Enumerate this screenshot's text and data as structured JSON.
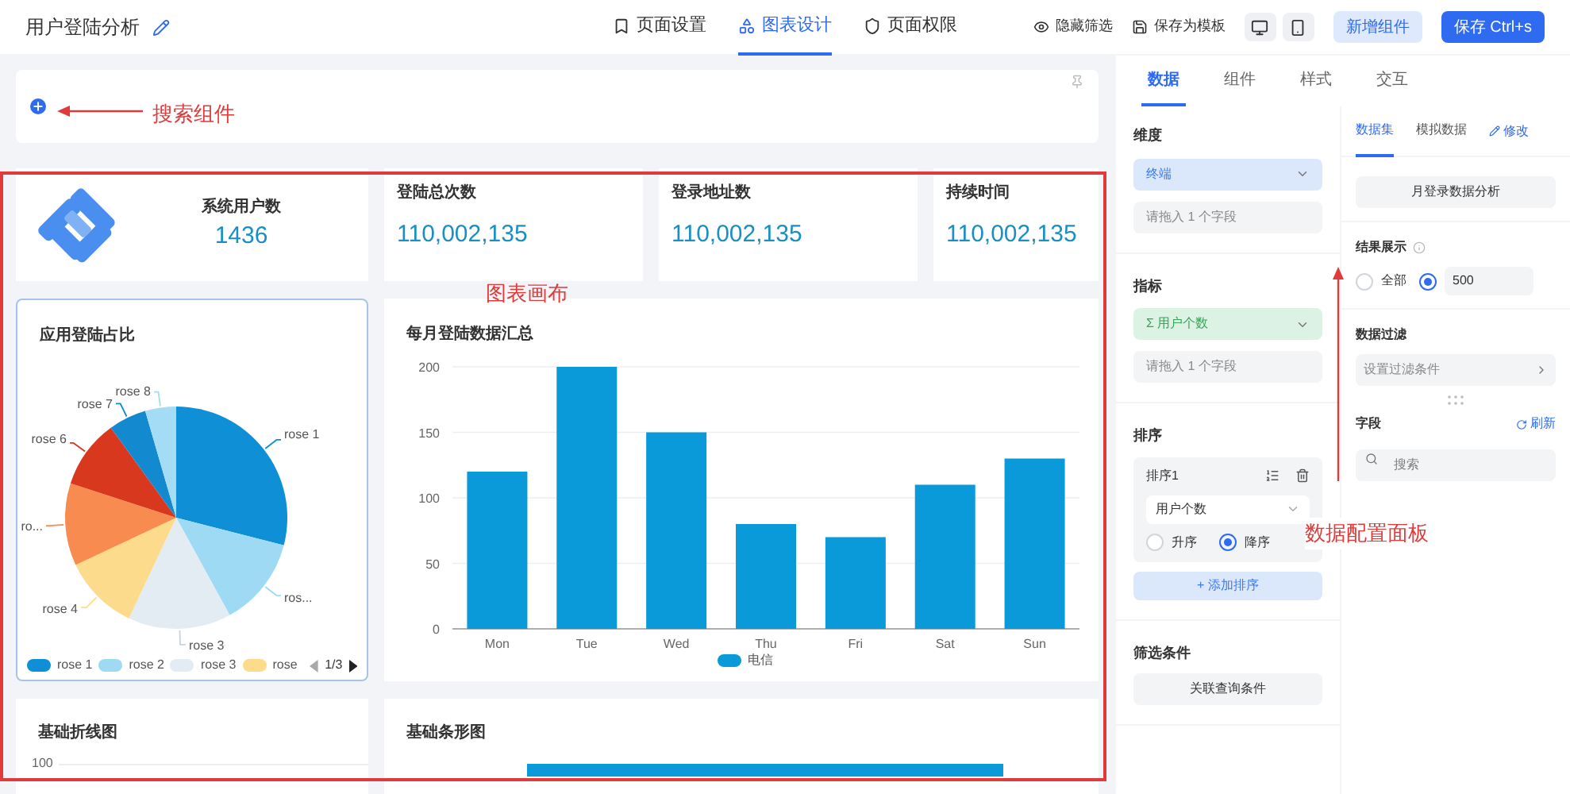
{
  "header": {
    "title": "用户登陆分析",
    "tabs": [
      {
        "label": "页面设置",
        "selected": false
      },
      {
        "label": "图表设计",
        "selected": true
      },
      {
        "label": "页面权限",
        "selected": false
      }
    ],
    "actions": [
      {
        "label": "隐藏筛选"
      },
      {
        "label": "保存为模板"
      }
    ],
    "devices": [
      {
        "kind": "desktop"
      },
      {
        "kind": "mobile"
      }
    ],
    "buttons": [
      {
        "label": "新增组件",
        "kind": "secondary"
      },
      {
        "label": "保存 Ctrl+s",
        "kind": "primary"
      }
    ]
  },
  "annotations": [
    {
      "label": "搜索组件"
    },
    {
      "label": "图表画布"
    },
    {
      "label": "数据配置面板"
    }
  ],
  "stats": [
    {
      "kind": "logo",
      "label": "系统用户数",
      "value": "1436"
    },
    {
      "kind": "plain",
      "label": "登陆总次数",
      "value": "110,002,135"
    },
    {
      "kind": "plain",
      "label": "登录地址数",
      "value": "110,002,135"
    },
    {
      "kind": "plain",
      "label": "持续时间",
      "value": "110,002,135"
    }
  ],
  "pie_card": {
    "title": "应用登陆占比",
    "slices": [
      {
        "label": "rose 1",
        "color": "#0e8fd6"
      },
      {
        "label": "ros...",
        "color": "#9fdaf5"
      },
      {
        "label": "rose 3",
        "color": "#e3ebf3"
      },
      {
        "label": "rose 4",
        "color": "#fcdb8c"
      },
      {
        "label": "ro...",
        "color": "#f78b50"
      },
      {
        "label": "rose 6",
        "color": "#d8381e"
      },
      {
        "label": "rose 7",
        "color": "#1389cf"
      },
      {
        "label": "rose 8",
        "color": "#a3dcf4"
      }
    ],
    "legend": [
      {
        "label": "rose 1",
        "color": "#0e8fd6"
      },
      {
        "label": "rose 2",
        "color": "#9fdaf5"
      },
      {
        "label": "rose 3",
        "color": "#e3ebf3"
      },
      {
        "label": "rose",
        "color": "#fcdb8c"
      }
    ],
    "page": "1/3"
  },
  "bar_card": {
    "title": "每月登陆数据汇总",
    "chart_data": {
      "type": "bar",
      "categories": [
        "Mon",
        "Tue",
        "Wed",
        "Thu",
        "Fri",
        "Sat",
        "Sun"
      ],
      "series": [
        {
          "name": "电信",
          "color": "#0b9ad9",
          "values": [
            120,
            200,
            150,
            80,
            70,
            110,
            130
          ]
        }
      ],
      "ylim": [
        0,
        200
      ],
      "yticks": [
        0,
        50,
        100,
        150,
        200
      ],
      "grid": true
    }
  },
  "bottom_cards": [
    {
      "title": "基础折线图",
      "tick": "100"
    },
    {
      "title": "基础条形图"
    }
  ],
  "config": {
    "tabs": [
      {
        "label": "数据",
        "selected": true
      },
      {
        "label": "组件",
        "selected": false
      },
      {
        "label": "样式",
        "selected": false
      },
      {
        "label": "交互",
        "selected": false
      }
    ],
    "dimension": {
      "title": "维度",
      "value": "终端",
      "placeholder": "请拖入 1 个字段"
    },
    "measure": {
      "title": "指标",
      "value": "Σ 用户个数",
      "placeholder": "请拖入 1 个字段"
    },
    "sort": {
      "title": "排序",
      "item": "排序1",
      "field": "用户个数",
      "options": [
        {
          "label": "升序",
          "selected": false
        },
        {
          "label": "降序",
          "selected": true
        }
      ],
      "add": "+ 添加排序"
    },
    "filter": {
      "title": "筛选条件",
      "button": "关联查询条件"
    }
  },
  "dataset": {
    "tabs": [
      {
        "label": "数据集",
        "selected": true
      },
      {
        "label": "模拟数据",
        "selected": false
      }
    ],
    "edit": "修改",
    "name": "月登录数据分析",
    "result": {
      "title": "结果展示",
      "options": [
        {
          "label": "全部",
          "selected": false
        },
        {
          "label": "500",
          "selected": true
        }
      ]
    },
    "filter": {
      "title": "数据过滤",
      "placeholder": "设置过滤条件"
    },
    "fields": {
      "title": "字段",
      "refresh": "刷新",
      "placeholder": "搜索"
    }
  }
}
